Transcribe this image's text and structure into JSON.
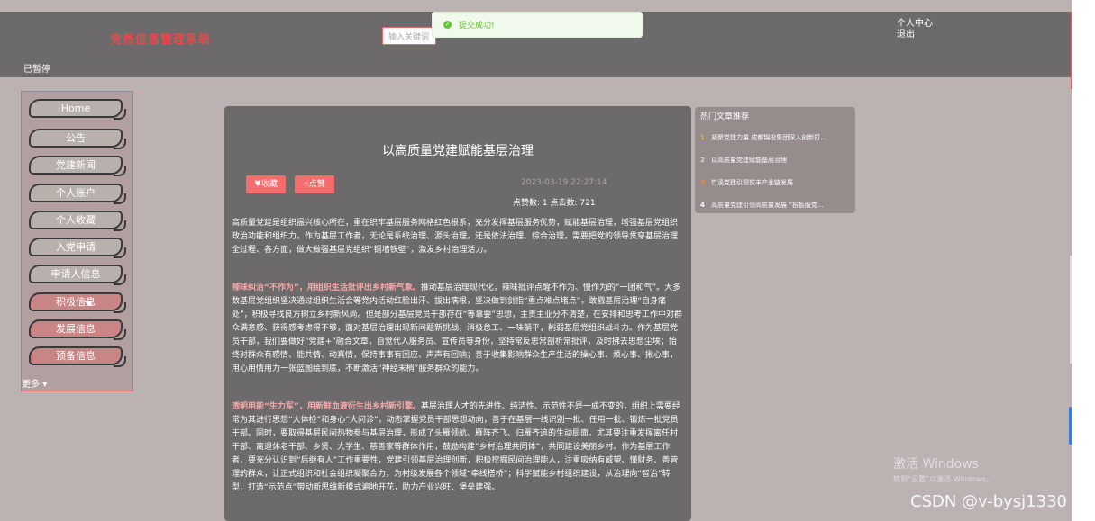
{
  "header": {
    "logo": "党员信息管理系统",
    "search_placeholder": "输入关键词",
    "toast": "提交成功!",
    "user_center": "个人中心",
    "logout": "退出",
    "paused": "已暂停"
  },
  "sidebar": {
    "items": [
      {
        "label": "Home"
      },
      {
        "label": "公告"
      },
      {
        "label": "党建新闻"
      },
      {
        "label": "个人账户"
      },
      {
        "label": "个人收藏"
      },
      {
        "label": "入党申请"
      },
      {
        "label": "申请人信息"
      },
      {
        "label": "积极信息"
      },
      {
        "label": "发展信息"
      },
      {
        "label": "预备信息"
      }
    ],
    "more": "更多"
  },
  "article": {
    "title": "以高质量党建赋能基层治理",
    "collect_label": "收藏",
    "like_label": "点赞",
    "date": "2023-03-19 22:27:14",
    "stats": "点赞数: 1   点击数: 721",
    "p1": "高质量党建是组织振兴核心所在，重在织牢基层服务网格红色根系，充分发挥基层服务优势，赋能基层治理，增强基层党组织政治功能和组织力。作为基层工作者，无论是系统治理、源头治理，还是依法治理、综合治理，需要把党的领导贯穿基层治理全过程、各方面，做大做强基层党组织“铜墙铁壁”，激发乡村治理活力。",
    "p2_hl": "辣味纠治“不作为”，用组织生活批评出乡村新气象。",
    "p2": "推动基层治理现代化，辣味批评点醒不作为、慢作为的“一团和气”。大多数基层党组织坚决通过组织生活会等党内活动红脸出汗、拔出病根，坚决做到剑指“重点难点堵点”，敢戳基层治理“自身痛处”，积极寻找良方树立乡村新风尚。但是部分基层党员干部存在“等靠要”思想，主责主业分不清楚，在安排和思考工作中对群众满意感、获得感考虑得不够，面对基层治理出现新问题新挑战，消极怠工、一味躺平，削弱基层党组织战斗力。作为基层党员干部，我们要做好“党建+”融合文章，自觉代入服务员、宣传员等身份，坚持常反思常剖析常批评，及时拂去思想尘埃；始终对群众有感情、能共情、动真情，保持事事有回应、声声有回响；善于收集影响群众生产生活的操心事、烦心事、揪心事，用心用情用力一张蓝图绘到底，不断激活“神经末梢”服务群众的能力。",
    "p3_hl": "透明用能“生力军”，用新鲜血液衍生出乡村新引擎。",
    "p3": "基层治理人才的先进性、纯洁性、示范性不是一成不变的，组织上需要经常为其进行思想“大体检”和身心“大问诊”，动态掌握党员干部思想动向，善于在基层一线识别一批、任用一批、锻炼一批党员干部。同时，要取得基层民间热物参与基层治理，形成了头雁领航、雁阵齐飞、归雁齐追的生动局面。尤其要注重发挥离任村干部、离退休老干部、乡贤、大学生、慈善家等群体作用，鼓励构建“乡村治理共同体”，共同建设美丽乡村。作为基层工作者，要充分认识到“后继有人”工作重要性，党建引领基层治理创新，积极挖掘民间治理能人，注重吸纳有威望、懂财务、善管理的群众，让正式组织和社会组织凝聚合力，为村级发展各个领域“牵线搭桥”；科学赋能乡村组织建设，从治理向“智治”转型，打造“示范点”带动新思维新模式遍地开花，助力产业兴旺、堡垒建强。"
  },
  "hot": {
    "title": "热门文章推荐",
    "items": [
      {
        "num": "1",
        "color": "#f2b12c",
        "text": "凝聚党建力量 成都锦投集团深入创新打..."
      },
      {
        "num": "2",
        "color": "#d6d6d6",
        "text": "以高质量党建赋能基层治理"
      },
      {
        "num": "3",
        "color": "#e38b3a",
        "text": "竹溪党建引领贫丰产业链发展"
      },
      {
        "num": "4",
        "color": "#ffffff",
        "text": "高质量党建引领高质量发展 “扮扳服党..."
      }
    ]
  },
  "watermark": {
    "win1": "激活 Windows",
    "win2": "转到“设置”以激活 Windows。",
    "csdn": "CSDN @v-bysj1330"
  }
}
